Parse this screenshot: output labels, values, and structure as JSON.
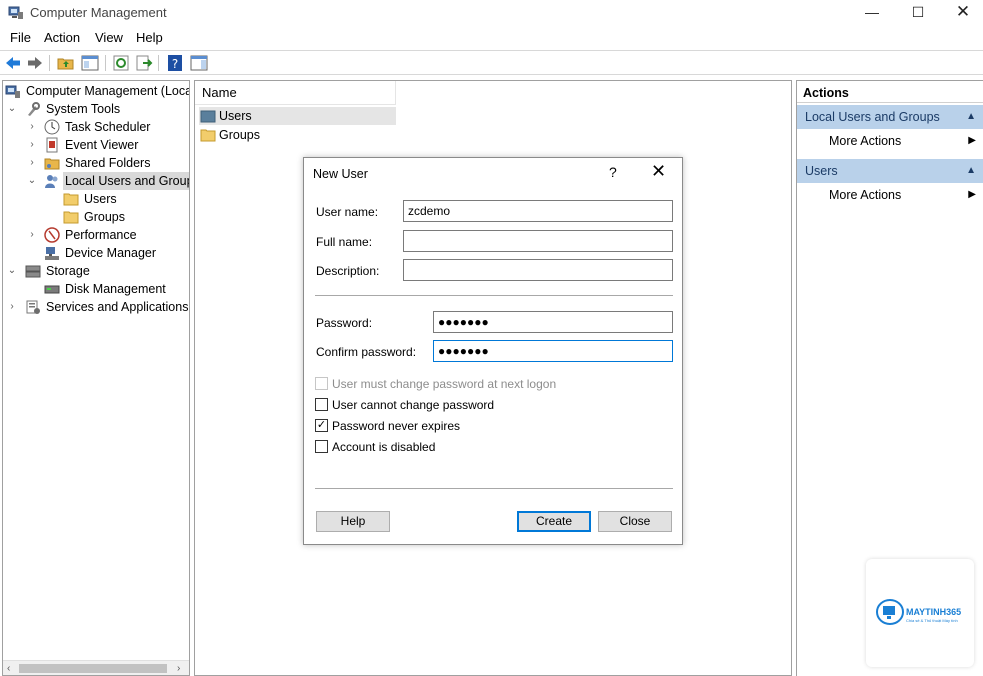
{
  "window": {
    "title": "Computer Management",
    "minimize": "—",
    "maximize": "☐",
    "close": "✕"
  },
  "menu": [
    "File",
    "Action",
    "View",
    "Help"
  ],
  "tree": {
    "items": [
      {
        "label": "Computer Management (Local",
        "icon": "computer-management-icon",
        "toggle": ""
      },
      {
        "label": "System Tools",
        "icon": "tools-icon",
        "toggle": "⌄"
      },
      {
        "label": "Task Scheduler",
        "icon": "clock-icon",
        "toggle": "›"
      },
      {
        "label": "Event Viewer",
        "icon": "event-viewer-icon",
        "toggle": "›"
      },
      {
        "label": "Shared Folders",
        "icon": "shared-folder-icon",
        "toggle": "›"
      },
      {
        "label": "Local Users and Groups",
        "icon": "users-group-icon",
        "toggle": "⌄"
      },
      {
        "label": "Users",
        "icon": "folder-icon",
        "toggle": ""
      },
      {
        "label": "Groups",
        "icon": "folder-icon",
        "toggle": ""
      },
      {
        "label": "Performance",
        "icon": "performance-icon",
        "toggle": "›"
      },
      {
        "label": "Device Manager",
        "icon": "device-manager-icon",
        "toggle": ""
      },
      {
        "label": "Storage",
        "icon": "storage-icon",
        "toggle": "⌄"
      },
      {
        "label": "Disk Management",
        "icon": "disk-icon",
        "toggle": ""
      },
      {
        "label": "Services and Applications",
        "icon": "services-icon",
        "toggle": "›"
      }
    ],
    "scroll_left": "‹",
    "scroll_right": "›"
  },
  "list": {
    "header": "Name",
    "rows": [
      {
        "label": "Users",
        "icon": "users-folder-icon"
      },
      {
        "label": "Groups",
        "icon": "folder-icon"
      }
    ]
  },
  "actions": {
    "title": "Actions",
    "sections": [
      {
        "title": "Local Users and Groups",
        "caret": "▲",
        "item": "More Actions",
        "item_caret": "▶"
      },
      {
        "title": "Users",
        "caret": "▲",
        "item": "More Actions",
        "item_caret": "▶"
      }
    ]
  },
  "dialog": {
    "title": "New User",
    "help": "?",
    "close": "✕",
    "fields": {
      "username_label": "User name:",
      "username_value": "zcdemo",
      "fullname_label": "Full name:",
      "fullname_value": "",
      "description_label": "Description:",
      "description_value": "",
      "password_label": "Password:",
      "password_value": "●●●●●●●",
      "confirm_label": "Confirm password:",
      "confirm_value": "●●●●●●●"
    },
    "checkboxes": [
      {
        "label": "User must change password at next logon",
        "checked": false,
        "disabled": true,
        "mark": ""
      },
      {
        "label": "User cannot change password",
        "checked": false,
        "disabled": false,
        "mark": ""
      },
      {
        "label": "Password never expires",
        "checked": true,
        "disabled": false,
        "mark": "✓"
      },
      {
        "label": "Account is disabled",
        "checked": false,
        "disabled": false,
        "mark": ""
      }
    ],
    "buttons": {
      "help": "Help",
      "create": "Create",
      "close": "Close"
    }
  },
  "watermark": {
    "name": "MAYTINH365",
    "tagline": "Chia sẻ & Thủ thuật Máy tính"
  },
  "colors": {
    "section_bg": "#b9d1ea",
    "focus": "#0078d7",
    "selection": "#d9d9d9"
  }
}
